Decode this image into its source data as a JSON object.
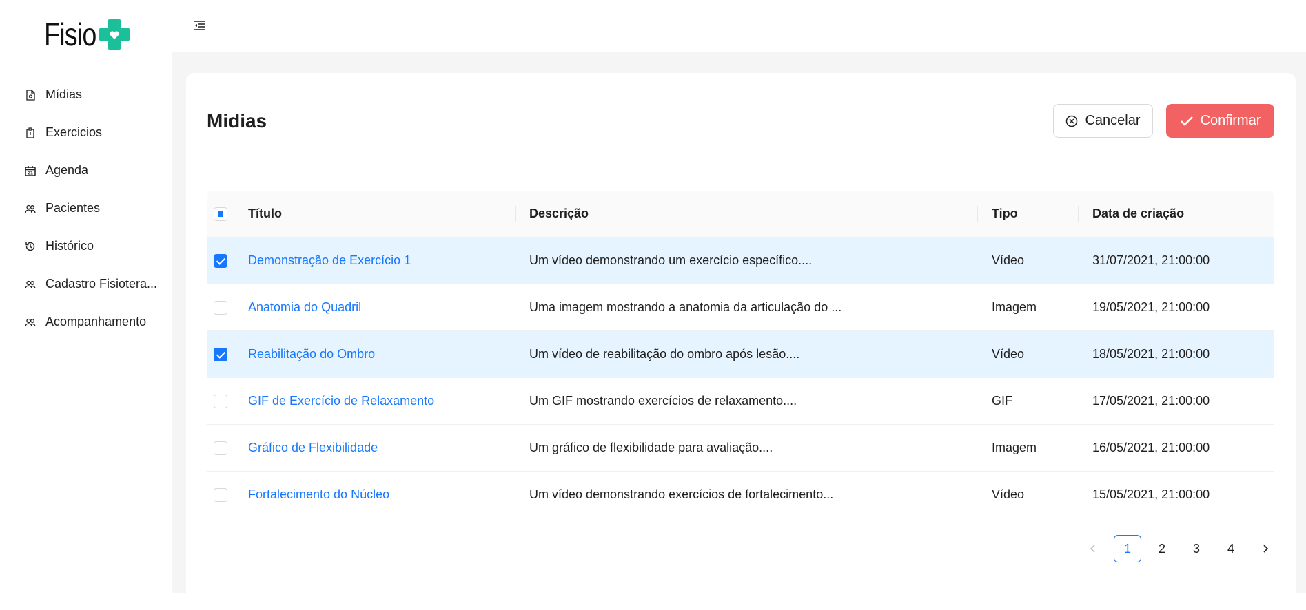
{
  "brand": {
    "logo_text": "Fisio",
    "accent": "#1bbf9a"
  },
  "sidebar": {
    "items": [
      {
        "label": "Mídias",
        "icon": "file-image-icon"
      },
      {
        "label": "Exercicios",
        "icon": "clipboard-icon"
      },
      {
        "label": "Agenda",
        "icon": "calendar-icon"
      },
      {
        "label": "Pacientes",
        "icon": "users-icon"
      },
      {
        "label": "Histórico",
        "icon": "history-icon"
      },
      {
        "label": "Cadastro Fisiotera...",
        "icon": "users-icon"
      },
      {
        "label": "Acompanhamento",
        "icon": "users-icon"
      }
    ]
  },
  "main": {
    "title": "Midias",
    "cancel_label": "Cancelar",
    "confirm_label": "Confirmar"
  },
  "table": {
    "columns": [
      "Título",
      "Descrição",
      "Tipo",
      "Data de criação"
    ],
    "header_checkbox": "indeterminate",
    "rows": [
      {
        "selected": true,
        "title": "Demonstração de Exercício 1",
        "description": "Um vídeo demonstrando um exercício específico....",
        "type": "Vídeo",
        "date": "31/07/2021, 21:00:00"
      },
      {
        "selected": false,
        "title": "Anatomia do Quadril",
        "description": "Uma imagem mostrando a anatomia da articulação do ...",
        "type": "Imagem",
        "date": "19/05/2021, 21:00:00"
      },
      {
        "selected": true,
        "title": "Reabilitação do Ombro",
        "description": "Um vídeo de reabilitação do ombro após lesão....",
        "type": "Vídeo",
        "date": "18/05/2021, 21:00:00"
      },
      {
        "selected": false,
        "title": "GIF de Exercício de Relaxamento",
        "description": "Um GIF mostrando exercícios de relaxamento....",
        "type": "GIF",
        "date": "17/05/2021, 21:00:00"
      },
      {
        "selected": false,
        "title": "Gráfico de Flexibilidade",
        "description": "Um gráfico de flexibilidade para avaliação....",
        "type": "Imagem",
        "date": "16/05/2021, 21:00:00"
      },
      {
        "selected": false,
        "title": "Fortalecimento do Núcleo",
        "description": "Um vídeo demonstrando exercícios de fortalecimento...",
        "type": "Vídeo",
        "date": "15/05/2021, 21:00:00"
      }
    ]
  },
  "pagination": {
    "pages": [
      "1",
      "2",
      "3",
      "4"
    ],
    "current": "1",
    "prev_icon": "chevron-left-icon",
    "next_icon": "chevron-right-icon"
  },
  "colors": {
    "primary": "#1677ff",
    "confirm": "#f26262",
    "selected_row": "#e6f4ff"
  }
}
